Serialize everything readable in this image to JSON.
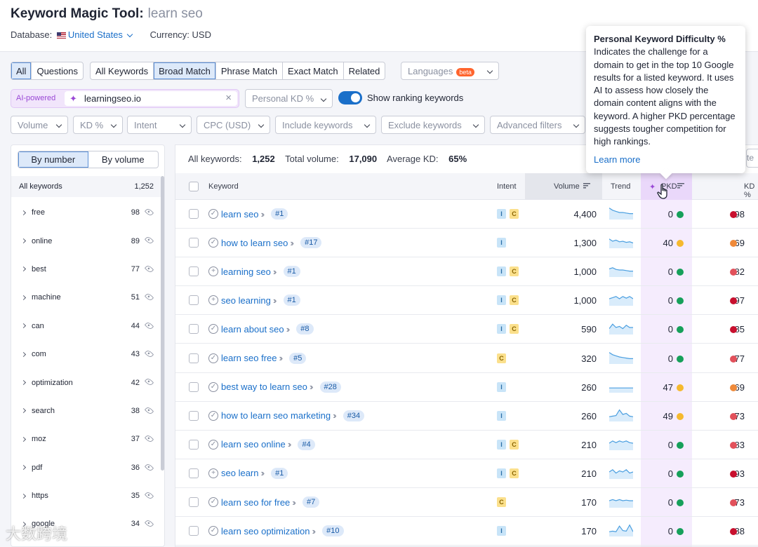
{
  "header": {
    "title": "Keyword Magic Tool:",
    "query": "learn seo",
    "database_label": "Database:",
    "database_value": "United States",
    "currency": "Currency: USD"
  },
  "filters": {
    "scope": [
      "All",
      "Questions"
    ],
    "match": [
      "All Keywords",
      "Broad Match",
      "Phrase Match",
      "Exact Match",
      "Related"
    ],
    "languages": "Languages",
    "beta": "beta",
    "ai_label": "AI-powered",
    "domain": "learningseo.io",
    "personal_kd": "Personal KD %",
    "show_ranking": "Show ranking keywords",
    "row2": [
      "Volume",
      "KD %",
      "Intent",
      "CPC (USD)",
      "Include keywords",
      "Exclude keywords",
      "Advanced filters"
    ],
    "export_peek": "te"
  },
  "sidebar": {
    "by_number": "By number",
    "by_volume": "By volume",
    "all_label": "All keywords",
    "all_count": "1,252",
    "items": [
      {
        "label": "free",
        "count": "98"
      },
      {
        "label": "online",
        "count": "89"
      },
      {
        "label": "best",
        "count": "77"
      },
      {
        "label": "machine",
        "count": "51"
      },
      {
        "label": "can",
        "count": "44"
      },
      {
        "label": "com",
        "count": "43"
      },
      {
        "label": "optimization",
        "count": "42"
      },
      {
        "label": "search",
        "count": "38"
      },
      {
        "label": "moz",
        "count": "37"
      },
      {
        "label": "pdf",
        "count": "36"
      },
      {
        "label": "https",
        "count": "35"
      },
      {
        "label": "google",
        "count": "34"
      }
    ]
  },
  "summary": {
    "all_label": "All keywords:",
    "all_value": "1,252",
    "vol_label": "Total volume:",
    "vol_value": "17,090",
    "kd_label": "Average KD:",
    "kd_value": "65%"
  },
  "table": {
    "headers": {
      "keyword": "Keyword",
      "intent": "Intent",
      "volume": "Volume",
      "trend": "Trend",
      "pkd": "PKD",
      "kd": "KD %"
    },
    "rows": [
      {
        "keyword": "learn seo",
        "icon": "check",
        "pos": "#1",
        "intent": [
          "I",
          "C"
        ],
        "volume": "4,400",
        "pkd": "0",
        "pkd_color": "#16a05a",
        "kd": "98",
        "kd_color": "#c8102e",
        "trend": [
          0.9,
          0.7,
          0.6,
          0.5,
          0.5,
          0.45,
          0.4,
          0.4
        ]
      },
      {
        "keyword": "how to learn seo",
        "icon": "check",
        "pos": "#17",
        "intent": [
          "I"
        ],
        "volume": "1,300",
        "pkd": "40",
        "pkd_color": "#f5b92e",
        "kd": "69",
        "kd_color": "#ef8a3a",
        "trend": [
          0.7,
          0.5,
          0.6,
          0.45,
          0.5,
          0.4,
          0.45,
          0.35
        ]
      },
      {
        "keyword": "learning seo",
        "icon": "plus",
        "pos": "#1",
        "intent": [
          "I",
          "C"
        ],
        "volume": "1,000",
        "pkd": "0",
        "pkd_color": "#16a05a",
        "kd": "82",
        "kd_color": "#e2515b",
        "trend": [
          0.6,
          0.7,
          0.55,
          0.5,
          0.5,
          0.45,
          0.4,
          0.4
        ]
      },
      {
        "keyword": "seo learning",
        "icon": "plus",
        "pos": "#1",
        "intent": [
          "I",
          "C"
        ],
        "volume": "1,000",
        "pkd": "0",
        "pkd_color": "#16a05a",
        "kd": "97",
        "kd_color": "#c8102e",
        "trend": [
          0.5,
          0.6,
          0.7,
          0.5,
          0.7,
          0.55,
          0.7,
          0.5
        ]
      },
      {
        "keyword": "learn about seo",
        "icon": "check",
        "pos": "#8",
        "intent": [
          "I",
          "C"
        ],
        "volume": "590",
        "pkd": "0",
        "pkd_color": "#16a05a",
        "kd": "85",
        "kd_color": "#c8102e",
        "trend": [
          0.4,
          0.8,
          0.5,
          0.6,
          0.4,
          0.7,
          0.5,
          0.5
        ]
      },
      {
        "keyword": "learn seo free",
        "icon": "check",
        "pos": "#5",
        "intent": [
          "C"
        ],
        "volume": "320",
        "pkd": "0",
        "pkd_color": "#16a05a",
        "kd": "77",
        "kd_color": "#e2515b",
        "trend": [
          0.9,
          0.7,
          0.6,
          0.5,
          0.45,
          0.4,
          0.35,
          0.35
        ]
      },
      {
        "keyword": "best way to learn seo",
        "icon": "check",
        "pos": "#28",
        "intent": [
          "I"
        ],
        "volume": "260",
        "pkd": "47",
        "pkd_color": "#f5b92e",
        "kd": "69",
        "kd_color": "#ef8a3a",
        "trend": [
          0.3,
          0.3,
          0.3,
          0.3,
          0.3,
          0.3,
          0.3,
          0.3
        ]
      },
      {
        "keyword": "how to learn seo marketing",
        "icon": "check",
        "pos": "#34",
        "intent": [
          "I"
        ],
        "volume": "260",
        "pkd": "49",
        "pkd_color": "#f5b92e",
        "kd": "73",
        "kd_color": "#e2515b",
        "trend": [
          0.3,
          0.35,
          0.4,
          0.9,
          0.5,
          0.6,
          0.35,
          0.3
        ]
      },
      {
        "keyword": "learn seo online",
        "icon": "check",
        "pos": "#4",
        "intent": [
          "I",
          "C"
        ],
        "volume": "210",
        "pkd": "0",
        "pkd_color": "#16a05a",
        "kd": "83",
        "kd_color": "#e2515b",
        "trend": [
          0.5,
          0.7,
          0.55,
          0.7,
          0.6,
          0.7,
          0.55,
          0.5
        ]
      },
      {
        "keyword": "seo learn",
        "icon": "plus",
        "pos": "#1",
        "intent": [
          "I",
          "C"
        ],
        "volume": "210",
        "pkd": "0",
        "pkd_color": "#16a05a",
        "kd": "93",
        "kd_color": "#c8102e",
        "trend": [
          0.5,
          0.7,
          0.4,
          0.6,
          0.5,
          0.7,
          0.4,
          0.5
        ]
      },
      {
        "keyword": "learn seo for free",
        "icon": "check",
        "pos": "#7",
        "intent": [
          "C"
        ],
        "volume": "170",
        "pkd": "0",
        "pkd_color": "#16a05a",
        "kd": "73",
        "kd_color": "#e2515b",
        "trend": [
          0.5,
          0.6,
          0.5,
          0.6,
          0.5,
          0.55,
          0.5,
          0.5
        ]
      },
      {
        "keyword": "learn seo optimization",
        "icon": "check",
        "pos": "#10",
        "intent": [
          "I"
        ],
        "volume": "170",
        "pkd": "0",
        "pkd_color": "#16a05a",
        "kd": "88",
        "kd_color": "#c8102e",
        "trend": [
          0.3,
          0.35,
          0.3,
          0.8,
          0.4,
          0.35,
          0.9,
          0.3
        ]
      }
    ]
  },
  "tooltip": {
    "title": "Personal Keyword Difficulty %",
    "body": "Indicates the challenge for a domain to get in the top 10 Google results for a listed keyword. It uses AI to assess how closely the domain content aligns with the keyword. A higher PKD percentage suggests tougher competition for high rankings.",
    "link": "Learn more"
  },
  "watermark": "大数跨境",
  "colors": {
    "accent": "#1a6fc9",
    "ai_purple": "#9a48d6"
  }
}
